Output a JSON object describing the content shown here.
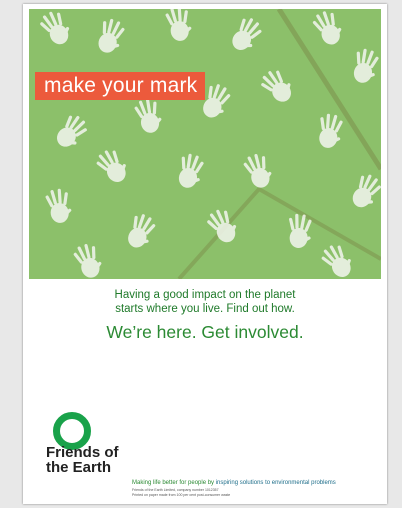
{
  "banner": {
    "text": "make your mark"
  },
  "tagline": {
    "line1": "Having a good impact on the planet",
    "line2": "starts where you live.  Find out how."
  },
  "cta": {
    "text": "We’re here. Get involved."
  },
  "logo": {
    "line1": "Friends of",
    "line2": "the Earth"
  },
  "footer": {
    "slogan_part1": "Making life better for people by ",
    "slogan_part2": "inspiring solutions to environmental problems",
    "legal_line1": "Friends of the Earth Limited, company number 1012357",
    "legal_line2": "Printed on paper made from 100 per cent post-consumer waste"
  },
  "colors": {
    "hero_green": "#8cc06a",
    "banner_red": "#ec5a3c",
    "brand_green": "#2b8a33",
    "logo_ring": "#19a24a"
  }
}
